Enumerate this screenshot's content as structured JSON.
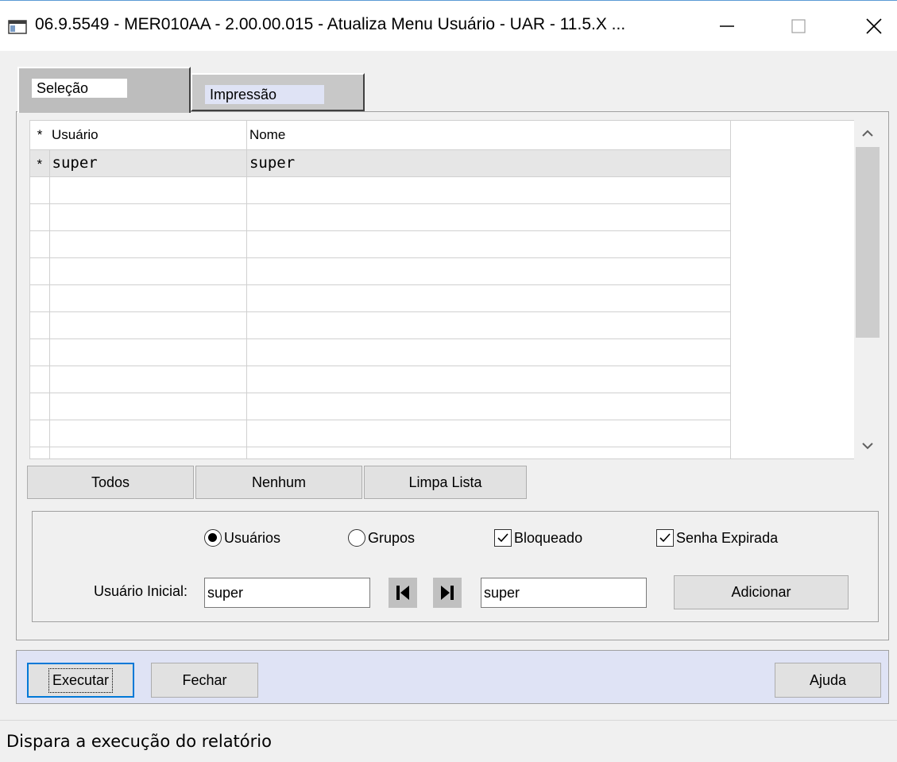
{
  "window": {
    "title": "06.9.5549 - MER010AA - 2.00.00.015 - Atualiza Menu Usuário - UAR - 11.5.X ...",
    "minimize_glyph": "—",
    "maximize_glyph": "☐",
    "close_glyph": "✕"
  },
  "tabs": [
    {
      "label": "Seleção",
      "active": true
    },
    {
      "label": "Impressão",
      "active": false
    }
  ],
  "grid": {
    "columns": [
      "*",
      "Usuário",
      "Nome"
    ],
    "rows": [
      {
        "indicator": "*",
        "usuario": "super",
        "nome": "super"
      }
    ],
    "scroll_up_glyph": "⌃",
    "scroll_down_glyph": "⌄"
  },
  "list_buttons": {
    "todos": "Todos",
    "nenhum": "Nenhum",
    "limpa_lista": "Limpa Lista"
  },
  "filters": {
    "radio_usuarios": {
      "label": "Usuários",
      "selected": true
    },
    "radio_grupos": {
      "label": "Grupos",
      "selected": false
    },
    "check_bloqueado": {
      "label": "Bloqueado",
      "checked": true
    },
    "check_senha_expirada": {
      "label": "Senha Expirada",
      "checked": true
    },
    "usuario_inicial_label": "Usuário Inicial:",
    "usuario_inicial_value": "super",
    "usuario_final_value": "super",
    "adicionar": "Adicionar"
  },
  "bottom_buttons": {
    "executar": "Executar",
    "fechar": "Fechar",
    "ajuda": "Ajuda"
  },
  "status": "Dispara a execução do relatório"
}
